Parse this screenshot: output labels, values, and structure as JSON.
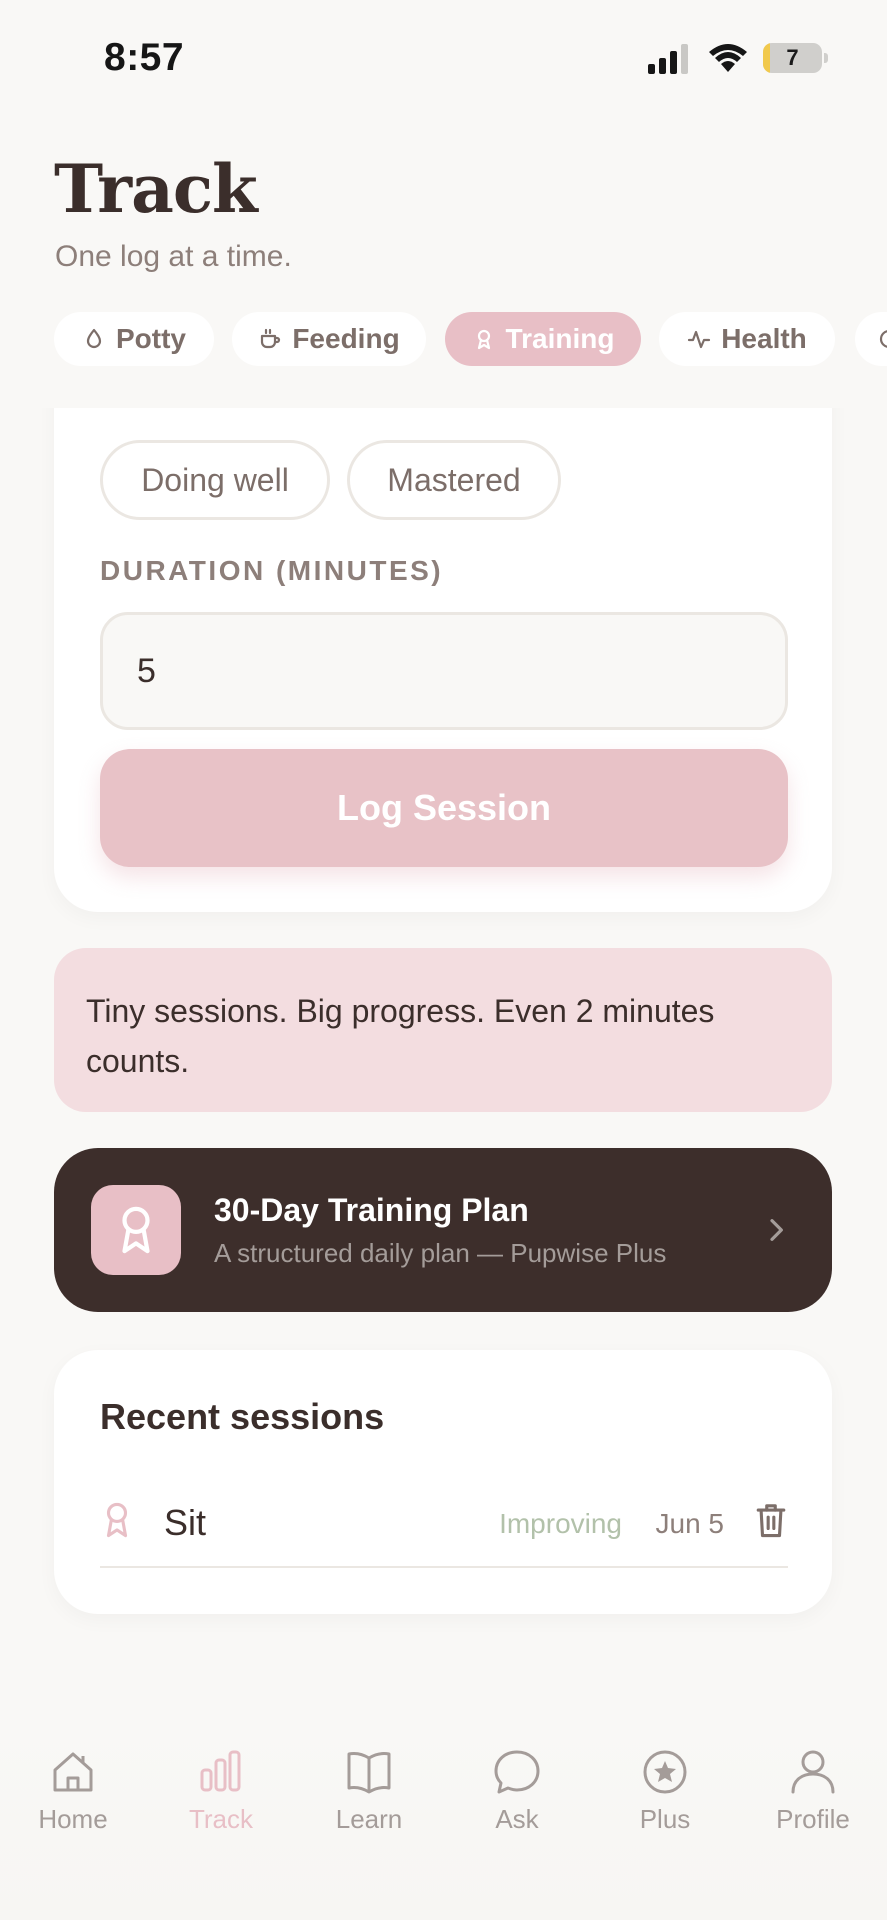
{
  "status_bar": {
    "time": "8:57",
    "battery_level": "7",
    "battery_fraction": 0.07
  },
  "header": {
    "title": "Track",
    "subtitle": "One log at a time."
  },
  "tabs": [
    {
      "label": "Potty",
      "icon": "drop-icon",
      "active": false
    },
    {
      "label": "Feeding",
      "icon": "cup-icon",
      "active": false
    },
    {
      "label": "Training",
      "icon": "ribbon-icon",
      "active": true
    },
    {
      "label": "Health",
      "icon": "pulse-icon",
      "active": false
    },
    {
      "label": "",
      "icon": "more-icon",
      "active": false
    }
  ],
  "training_form": {
    "progress_options": [
      "",
      "",
      "Doing well",
      "Mastered"
    ],
    "selected_progress_color": "#bccbb4",
    "duration_label": "DURATION (MINUTES)",
    "duration_value": "5",
    "submit_label": "Log Session"
  },
  "tip": {
    "text": "Tiny sessions. Big progress. Even 2 minutes counts."
  },
  "plan_banner": {
    "title": "30-Day Training Plan",
    "subtitle": "A structured daily plan — Pupwise Plus"
  },
  "recent": {
    "title": "Recent sessions",
    "sessions": [
      {
        "name": "Sit",
        "status": "Improving",
        "date": "Jun 5"
      }
    ]
  },
  "nav": [
    {
      "label": "Home",
      "icon": "home-icon",
      "active": false
    },
    {
      "label": "Track",
      "icon": "bar-chart-icon",
      "active": true
    },
    {
      "label": "Learn",
      "icon": "book-icon",
      "active": false
    },
    {
      "label": "Ask",
      "icon": "chat-bubble-icon",
      "active": false
    },
    {
      "label": "Plus",
      "icon": "star-circle-icon",
      "active": false
    },
    {
      "label": "Profile",
      "icon": "person-icon",
      "active": false
    }
  ],
  "colors": {
    "accent_pink": "#e8bfc6",
    "sage_green": "#bccbb4",
    "dark_brown": "#3d2e2b",
    "background": "#f9f8f6"
  }
}
